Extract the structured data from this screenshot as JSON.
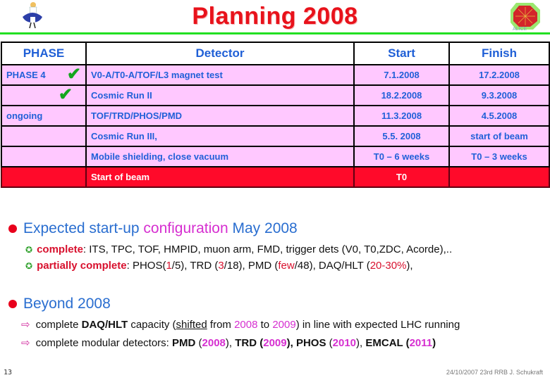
{
  "slide": {
    "title": "Planning 2008",
    "page_number": "13",
    "footer": "24/10/2007 23rd RRB J. Schukraft",
    "colors": {
      "title": "#e8121b",
      "rule": "#22e022",
      "row_bg": "#ffc8ff",
      "beam_row_bg": "#ff0a2a",
      "table_text": "#2060d8",
      "highlight_red": "#d8112e",
      "highlight_magenta": "#d62fd0"
    }
  },
  "table": {
    "headers": [
      "PHASE",
      "Detector",
      "Start",
      "Finish"
    ],
    "rows": [
      {
        "phase": "PHASE 4",
        "check": "✔",
        "detector": "V0-A/T0-A/TOF/L3 magnet test",
        "start": "7.1.2008",
        "finish": "17.2.2008"
      },
      {
        "phase": "",
        "check": "✔",
        "detector": "Cosmic Run II",
        "start": "18.2.2008",
        "finish": "9.3.2008"
      },
      {
        "phase": "ongoing",
        "check": "",
        "detector": "TOF/TRD/PHOS/PMD",
        "start": "11.3.2008",
        "finish": "4.5.2008"
      },
      {
        "phase": "",
        "check": "",
        "detector": "Cosmic Run III,",
        "start": "5.5. 2008",
        "finish": "start of beam"
      },
      {
        "phase": "",
        "check": "",
        "detector": "Mobile shielding, close vacuum",
        "start": "T0 – 6 weeks",
        "finish": "T0 – 3 weeks"
      },
      {
        "phase": "",
        "check": "",
        "detector": "Start of beam",
        "start": "T0",
        "finish": ""
      }
    ]
  },
  "section1": {
    "heading_a": "Expected start-up ",
    "heading_b": "configuration",
    "heading_c": " May 2008",
    "complete_label": "complete",
    "complete_text": ": ITS, TPC, TOF, HMPID, muon arm, FMD, trigger dets (V0, T0,ZDC, Acorde),..",
    "partial_label": "partially complete",
    "partial_parts": [
      ": PHOS(",
      "1",
      "/5), TRD (",
      "3",
      "/18), PMD (",
      "few",
      "/48), DAQ/HLT (",
      "20-30%",
      "),"
    ]
  },
  "section2": {
    "heading": "Beyond 2008",
    "line1": [
      "complete ",
      "DAQ/HLT",
      " capacity (",
      "shifted",
      " from ",
      "2008",
      " to ",
      "2009",
      ") in line with expected LHC running"
    ],
    "line2": [
      "complete modular detectors: ",
      "PMD",
      " (",
      "2008",
      "), ",
      "TRD (",
      "2009",
      "), PHOS",
      " (",
      "2010",
      "), ",
      "EMCAL (",
      "2011",
      ")"
    ]
  },
  "icons": {
    "bullet_star": "✪",
    "bullet_arrow": "⇨",
    "logo_left": "alice-figure-logo",
    "logo_right": "alice-detector-logo"
  }
}
